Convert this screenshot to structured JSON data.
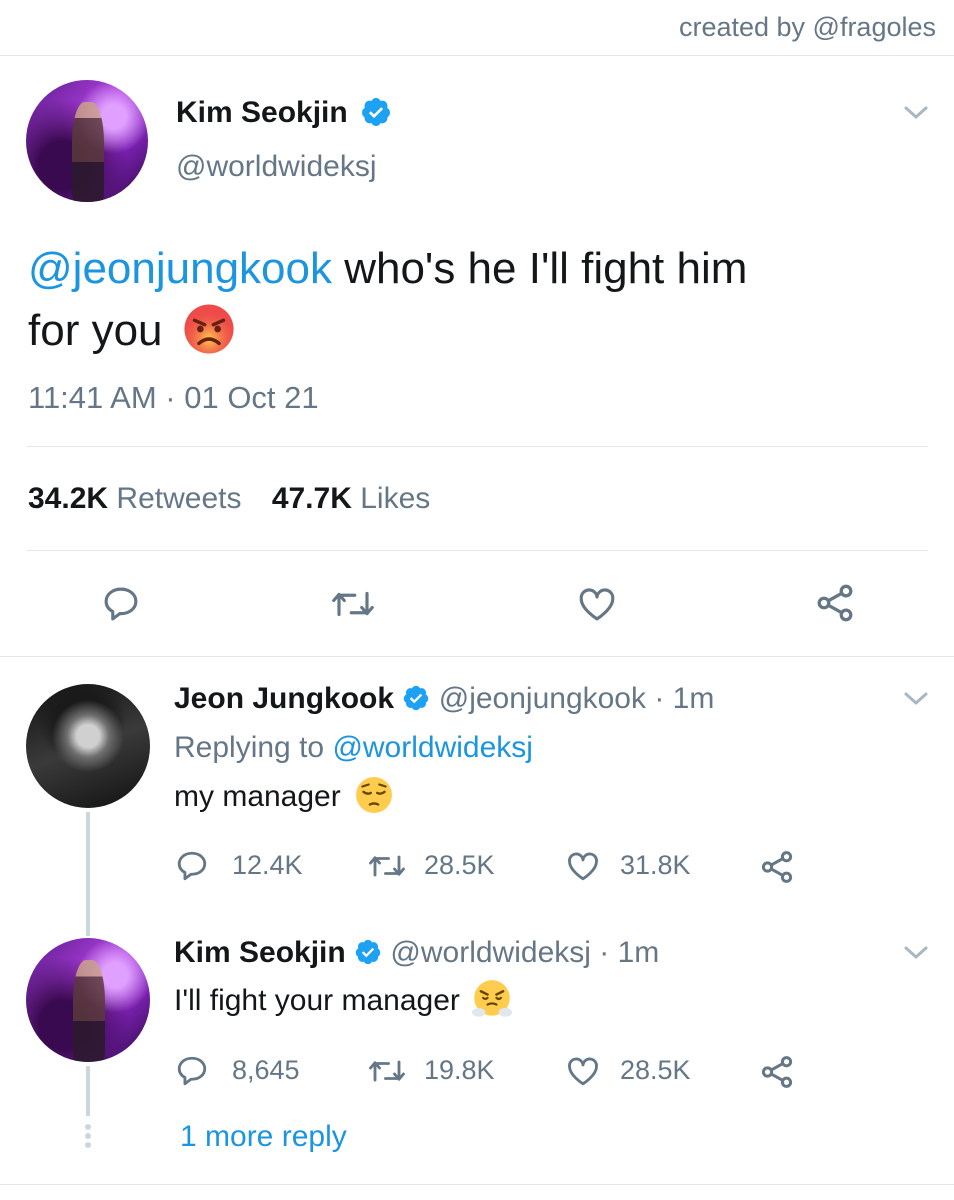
{
  "credit": "created by @fragoles",
  "main_tweet": {
    "name": "Kim Seokjin",
    "handle": "@worldwideksj",
    "mention": "@jeonjungkook",
    "text_line1": " who's he I'll fight him",
    "text_line2": "for you",
    "emoji": "pouting-face",
    "timestamp": "11:41 AM · 01 Oct 21",
    "retweets_count": "34.2K",
    "retweets_label": "Retweets",
    "likes_count": "47.7K",
    "likes_label": "Likes"
  },
  "replies": [
    {
      "name": "Jeon Jungkook",
      "handle": "@jeonjungkook",
      "time": "· 1m",
      "replying_prefix": "Replying to ",
      "replying_handle": "@worldwideksj",
      "text": "my manager",
      "emoji": "pensive-face",
      "reply_count": "12.4K",
      "retweet_count": "28.5K",
      "like_count": "31.8K"
    },
    {
      "name": "Kim Seokjin",
      "handle": "@worldwideksj",
      "time": "· 1m",
      "text": "I'll fight your manager",
      "emoji": "face-with-steam",
      "reply_count": "8,645",
      "retweet_count": "19.8K",
      "like_count": "28.5K"
    }
  ],
  "more_replies": "1 more reply",
  "colors": {
    "accent": "#1b95e0",
    "secondary": "#657786",
    "divider": "#e1e8ed"
  }
}
